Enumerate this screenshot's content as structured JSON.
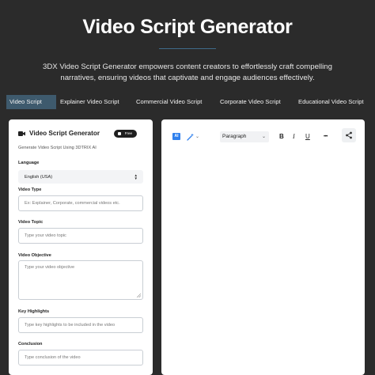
{
  "header": {
    "title": "Video Script Generator",
    "description_line1": "3DX Video Script Generator empowers content creators to effortlessly craft compelling",
    "description_line2": "narratives, ensuring videos that captivate and engage audiences effectively."
  },
  "tabs": [
    {
      "label": "Video Script",
      "active": true
    },
    {
      "label": "Explainer Video Script",
      "active": false
    },
    {
      "label": "Commercial Video Script",
      "active": false
    },
    {
      "label": "Corporate Video Script",
      "active": false
    },
    {
      "label": "Educational Video Script",
      "active": false
    }
  ],
  "form": {
    "icon": "video-camera-icon",
    "title": "Video Script Generator",
    "badge": "Free",
    "subtitle": "Generate Video Script Using 3DTRIX AI",
    "language_label": "Language",
    "language_value": "English (USA)",
    "video_type_label": "Video Type",
    "video_type_placeholder": "Ex: Explainer, Corporate, commercial videos etc.",
    "video_topic_label": "Video Topic",
    "video_topic_placeholder": "Type your video topic",
    "video_objective_label": "Video Objective",
    "video_objective_placeholder": "Type your video objective",
    "key_highlights_label": "Key Highlights",
    "key_highlights_placeholder": "Type key highlights to be included in the video",
    "conclusion_label": "Conclusion",
    "conclusion_placeholder": "Type conclusion of the video"
  },
  "editor": {
    "ai_label": "AI",
    "format_value": "Paragraph",
    "bold_label": "B",
    "italic_label": "I",
    "underline_label": "U",
    "more_label": "•••",
    "icons": [
      "ai-icon",
      "magic-wand-icon",
      "share-icon"
    ]
  },
  "colors": {
    "background": "#2b2b2b",
    "active_tab": "#3e5a6d",
    "accent_blue": "#2f80ed",
    "panel": "#ffffff"
  }
}
